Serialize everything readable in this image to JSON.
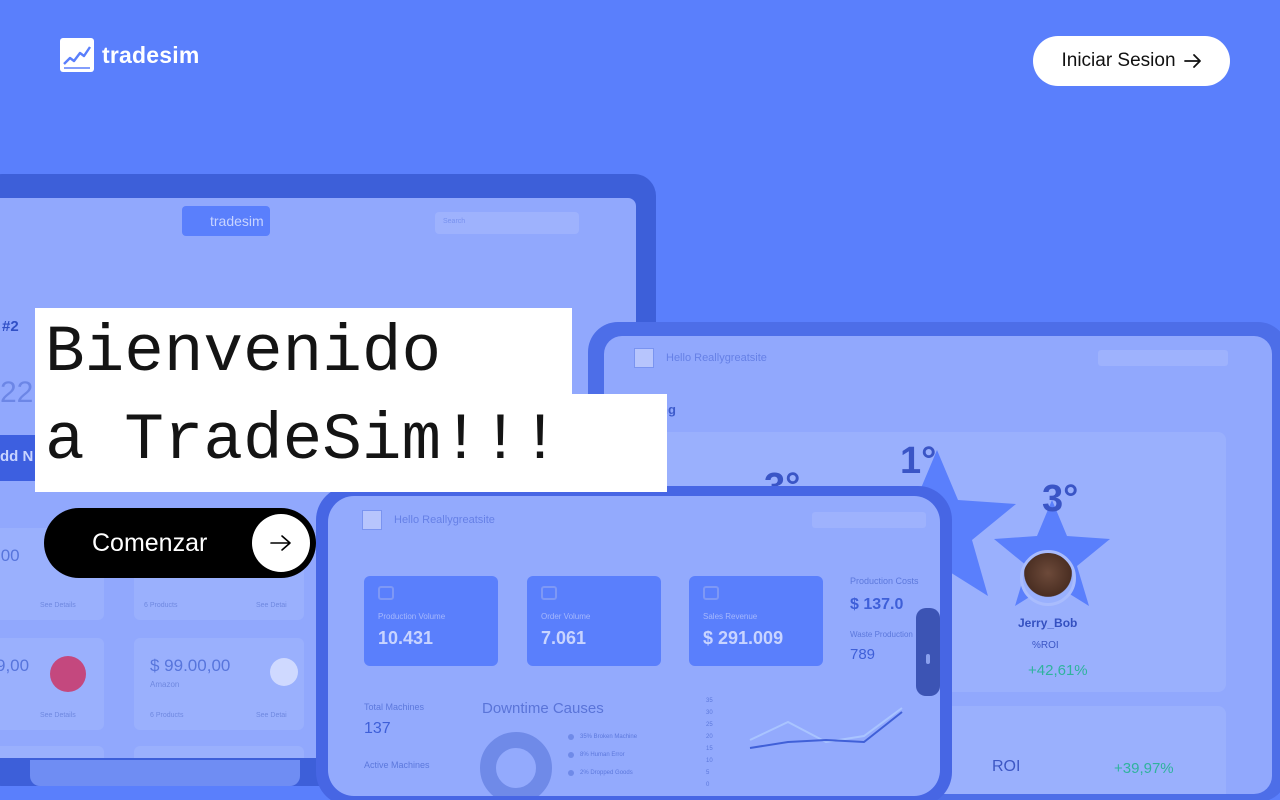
{
  "brand": {
    "name": "tradesim",
    "color": "#5a7ffc"
  },
  "header": {
    "login_label": "Iniciar Sesion",
    "login_icon": "arrow-right-icon"
  },
  "hero": {
    "title_line1": "Bienvenido",
    "title_line2": "a TradeSim!!!",
    "cta_label": "Comenzar",
    "cta_icon": "arrow-right-icon"
  },
  "laptop_mock": {
    "logo": "tradesim",
    "search_placeholder": "Search",
    "rank": "#2",
    "big_value": "22,",
    "add_button": "dd N",
    "cards": [
      {
        "amount": ",00",
        "detail_a": "See Details",
        "detail_b": ""
      },
      {
        "amount": "",
        "detail_a": "6 Products",
        "detail_b": "See Detai"
      },
      {
        "amount": "9,00",
        "detail_a": "See Details",
        "detail_b": ""
      },
      {
        "amount": "$ 99.00,00",
        "sub": "Amazon",
        "detail_a": "6 Products",
        "detail_b": "See Detai"
      }
    ]
  },
  "tablet_mock": {
    "greeting": "Hello Reallygreatsite",
    "search_placeholder": "Search",
    "ranking_label": "ng",
    "ranks": [
      "1°",
      "3°",
      "3°"
    ],
    "player_name": "Jerry_Bob",
    "player_metric": "%ROI",
    "player_change": "+42,61%",
    "roi_label": "ROI",
    "roi_change": "+39,97%"
  },
  "phone_mock": {
    "greeting": "Hello Reallygreatsite",
    "search_placeholder": "Search",
    "stats": [
      {
        "label": "Production Volume",
        "value": "10.431"
      },
      {
        "label": "Order Volume",
        "value": "7.061"
      },
      {
        "label": "Sales Revenue",
        "value": "$ 291.009"
      }
    ],
    "production_costs_label": "Production Costs",
    "production_costs_value": "$ 137.0",
    "waste_label": "Waste Production",
    "waste_value": "789",
    "total_machines_label": "Total Machines",
    "total_machines_value": "137",
    "active_machines_label": "Active Machines",
    "downtime_title": "Downtime Causes",
    "legend": [
      "35% Broken Machine",
      "8% Human Error",
      "2% Dropped Goods"
    ],
    "chart_y_ticks": [
      "35",
      "30",
      "25",
      "20",
      "15",
      "10",
      "5",
      "0"
    ]
  }
}
